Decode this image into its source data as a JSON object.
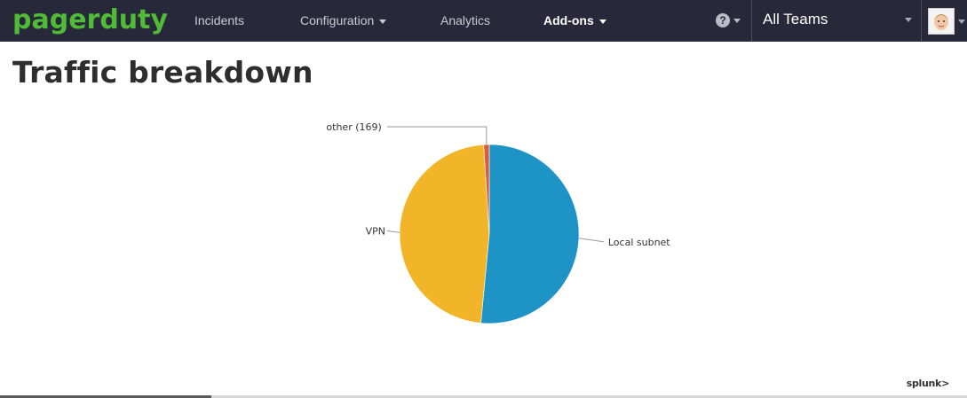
{
  "header": {
    "logo": "pagerduty",
    "nav": [
      {
        "label": "Incidents"
      },
      {
        "label": "Configuration"
      },
      {
        "label": "Analytics"
      },
      {
        "label": "Add-ons"
      }
    ],
    "help_icon": "question-circle-icon",
    "teams_selector": "All Teams",
    "colors": {
      "bar": "#27293a",
      "logo": "#4fbb36"
    }
  },
  "page": {
    "title": "Traffic breakdown",
    "footer_brand": "splunk>"
  },
  "chart_data": {
    "type": "pie",
    "labels": [
      "Local subnet",
      "VPN",
      "other (169)"
    ],
    "values": [
      51.5,
      47.5,
      1.0
    ],
    "colors": [
      "#1e93c6",
      "#f2b428",
      "#d85d3c"
    ]
  }
}
